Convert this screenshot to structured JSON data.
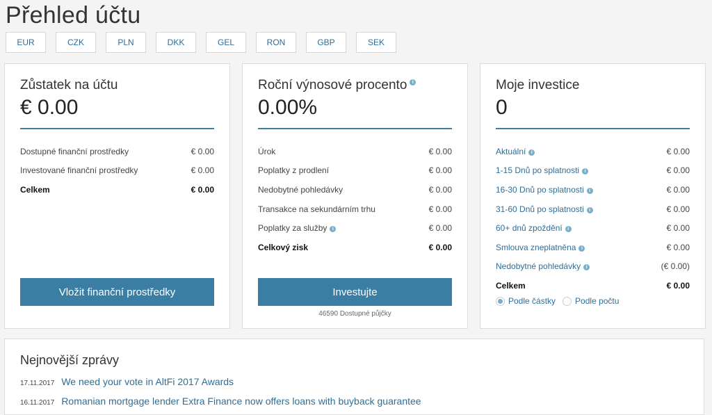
{
  "page_title": "Přehled účtu",
  "currencies": [
    "EUR",
    "CZK",
    "PLN",
    "DKK",
    "GEL",
    "RON",
    "GBP",
    "SEK"
  ],
  "balance": {
    "title": "Zůstatek na účtu",
    "value": "€ 0.00",
    "rows": [
      {
        "label": "Dostupné finanční prostředky",
        "value": "€ 0.00"
      },
      {
        "label": "Investované finanční prostředky",
        "value": "€ 0.00"
      }
    ],
    "total": {
      "label": "Celkem",
      "value": "€ 0.00"
    },
    "button": "Vložit finanční prostředky"
  },
  "yield": {
    "title": "Roční výnosové procento",
    "value": "0.00%",
    "rows": [
      {
        "label": "Úrok",
        "value": "€ 0.00"
      },
      {
        "label": "Poplatky z prodlení",
        "value": "€ 0.00"
      },
      {
        "label": "Nedobytné pohledávky",
        "value": "€ 0.00"
      },
      {
        "label": "Transakce na sekundárním trhu",
        "value": "€ 0.00"
      },
      {
        "label": "Poplatky za služby",
        "value": "€ 0.00"
      }
    ],
    "total": {
      "label": "Celkový zisk",
      "value": "€ 0.00"
    },
    "button": "Investujte",
    "note": "46590 Dostupné půjčky"
  },
  "investments": {
    "title": "Moje investice",
    "value": "0",
    "rows": [
      {
        "label": "Aktuální",
        "value": "€ 0.00"
      },
      {
        "label": "1-15 Dnů po splatnosti",
        "value": "€ 0.00"
      },
      {
        "label": "16-30 Dnů po splatnosti",
        "value": "€ 0.00"
      },
      {
        "label": "31-60 Dnů po splatnosti",
        "value": "€ 0.00"
      },
      {
        "label": "60+ dnů zpoždění",
        "value": "€ 0.00"
      },
      {
        "label": "Smlouva zneplatněna",
        "value": "€ 0.00"
      },
      {
        "label": "Nedobytné pohledávky",
        "value": "(€ 0.00)"
      }
    ],
    "total": {
      "label": "Celkem",
      "value": "€ 0.00"
    },
    "radio_amount": "Podle částky",
    "radio_count": "Podle počtu"
  },
  "news": {
    "title": "Nejnovější zprávy",
    "items": [
      {
        "date": "17.11.2017",
        "title": "We need your vote in AltFi 2017 Awards"
      },
      {
        "date": "16.11.2017",
        "title": "Romanian mortgage lender Extra Finance now offers loans with buyback guarantee"
      }
    ]
  },
  "colors": {
    "accent": "#3a7ea4",
    "link": "#2f6d96",
    "info_icon": "#7aaec8"
  }
}
